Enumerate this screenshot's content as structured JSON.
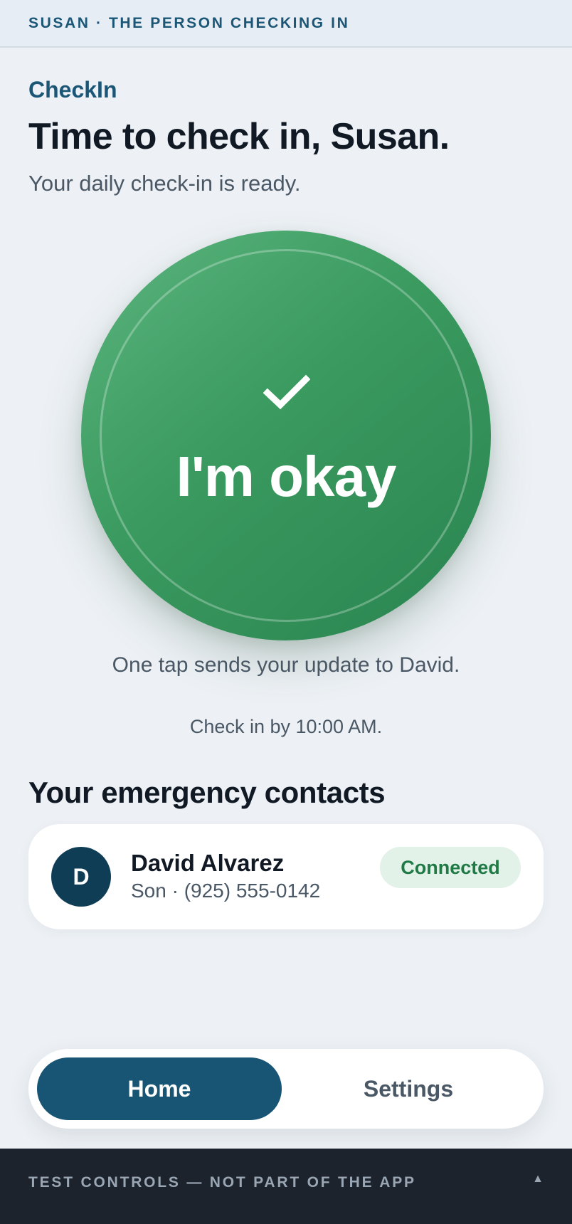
{
  "topbar": {
    "text": "SUSAN · THE PERSON CHECKING IN"
  },
  "header": {
    "brand": "CheckIn",
    "title": "Time to check in, Susan.",
    "subtitle": "Your daily check-in is ready."
  },
  "checkin": {
    "icon": "check-icon",
    "button_label": "I'm okay",
    "hint": "One tap sends your update to David.",
    "deadline": "Check in by 10:00 AM."
  },
  "contacts": {
    "title": "Your emergency contacts",
    "items": [
      {
        "initial": "D",
        "name": "David Alvarez",
        "detail": "Son · (925) 555-0142",
        "status": "Connected"
      }
    ]
  },
  "nav": {
    "home_label": "Home",
    "settings_label": "Settings",
    "active": "Home"
  },
  "test_controls": {
    "label": "TEST CONTROLS — NOT PART OF THE APP",
    "toggle_icon": "▲"
  },
  "colors": {
    "accent": "#1b5676",
    "ok_green": "#3a9a5f",
    "nav_active": "#185575",
    "status_green": "#1f7a46"
  }
}
